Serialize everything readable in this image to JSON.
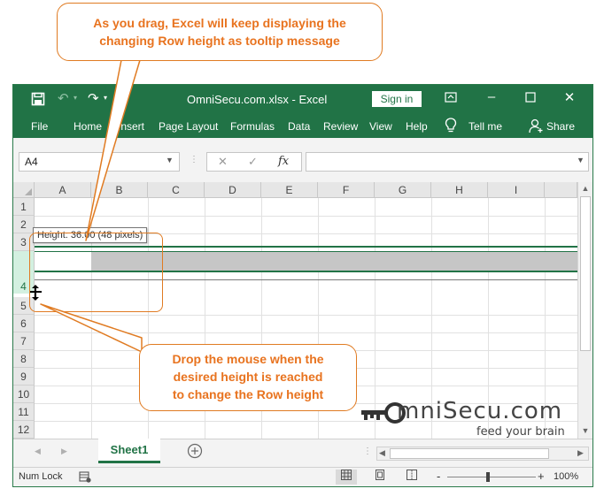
{
  "titlebar": {
    "file_title": "OmniSecu.com.xlsx",
    "separator": "-",
    "app_name": "Excel",
    "signin_label": "Sign in",
    "save_icon": "save-icon",
    "undo_icon": "undo-icon",
    "redo_icon": "redo-icon"
  },
  "ribbon": {
    "tabs": [
      "File",
      "Home",
      "Insert",
      "Page Layout",
      "Formulas",
      "Data",
      "Review",
      "View",
      "Help"
    ],
    "tell_me": "Tell me",
    "share": "Share"
  },
  "formula_bar": {
    "name_box": "A4",
    "fx_label": "fx",
    "value": ""
  },
  "grid": {
    "columns": [
      "A",
      "B",
      "C",
      "D",
      "E",
      "F",
      "G",
      "H",
      "I"
    ],
    "rows": [
      "1",
      "2",
      "3",
      "4",
      "5",
      "6",
      "7",
      "8",
      "9",
      "10",
      "11",
      "12"
    ],
    "selected_cell": "A4",
    "tooltip": "Height: 36.00 (48 pixels)"
  },
  "sheets": {
    "tabs": [
      "Sheet1"
    ],
    "active": "Sheet1"
  },
  "statusbar": {
    "mode": "Num Lock",
    "zoom_minus": "-",
    "zoom_plus": "+",
    "zoom_level": "100%"
  },
  "callouts": {
    "top_line1": "As you drag, Excel will keep displaying the",
    "top_line2": "changing Row height as tooltip message",
    "bottom_line1": "Drop the mouse when the",
    "bottom_line2": "desired height is reached",
    "bottom_line3": "to change the Row height"
  },
  "logo": {
    "brand": "mniSecu.com",
    "tagline": "feed your brain"
  },
  "colors": {
    "excel_green": "#217346",
    "callout_orange": "#e8731f"
  }
}
